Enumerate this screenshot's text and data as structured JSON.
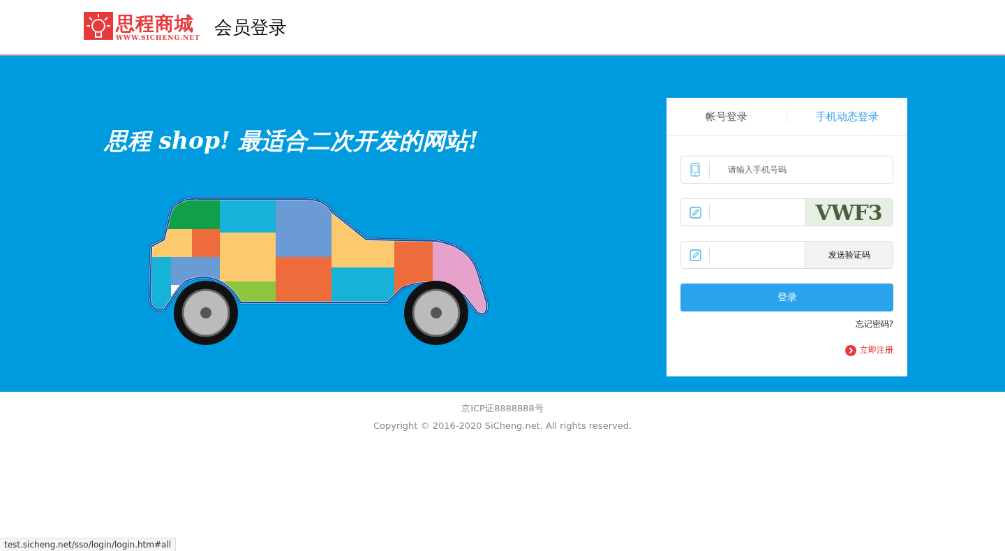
{
  "header": {
    "logo": {
      "name": "思程商城",
      "url": "WWW.SICHENG.NET"
    },
    "title": "会员登录"
  },
  "banner": {
    "slogan": "思程 shop! 最适合二次开发的网站!"
  },
  "login": {
    "tabs": [
      {
        "label": "帐号登录",
        "selected": false
      },
      {
        "label": "手机动态登录",
        "selected": true
      }
    ],
    "phone": {
      "placeholder": "请输入手机号码"
    },
    "captcha": {
      "code": "VWF3"
    },
    "sms_button": "发送验证码",
    "submit": "登录",
    "forgot": "忘记密码?",
    "register": "立即注册"
  },
  "footer": {
    "icp": "京ICP证8888888号",
    "copyright": "Copyright © 2016-2020 SiCheng.net. All rights reserved."
  },
  "status_bar": "test.sicheng.net/sso/login/login.htm#all"
}
